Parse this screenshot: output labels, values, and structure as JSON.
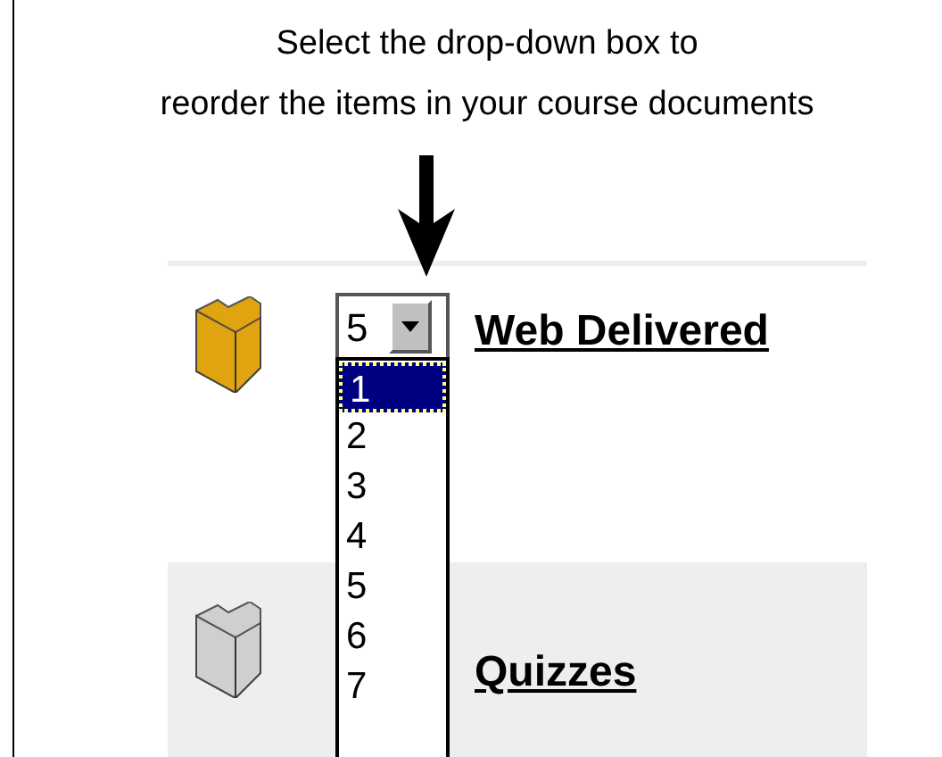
{
  "caption": [
    "Select the drop-down box to",
    "reorder the items in your course documents"
  ],
  "items": [
    {
      "name": "Web Delivered",
      "order": "5",
      "color": "#e0a410"
    },
    {
      "name": "Quizzes",
      "color": "#cfcfcf"
    }
  ],
  "dropdown": {
    "options": [
      {
        "label": "1",
        "selected": true
      },
      {
        "label": "2",
        "selected": false
      },
      {
        "label": "3",
        "selected": false
      },
      {
        "label": "4",
        "selected": false
      },
      {
        "label": "5",
        "selected": false
      },
      {
        "label": "6",
        "selected": false
      },
      {
        "label": "7",
        "selected": false
      }
    ]
  }
}
